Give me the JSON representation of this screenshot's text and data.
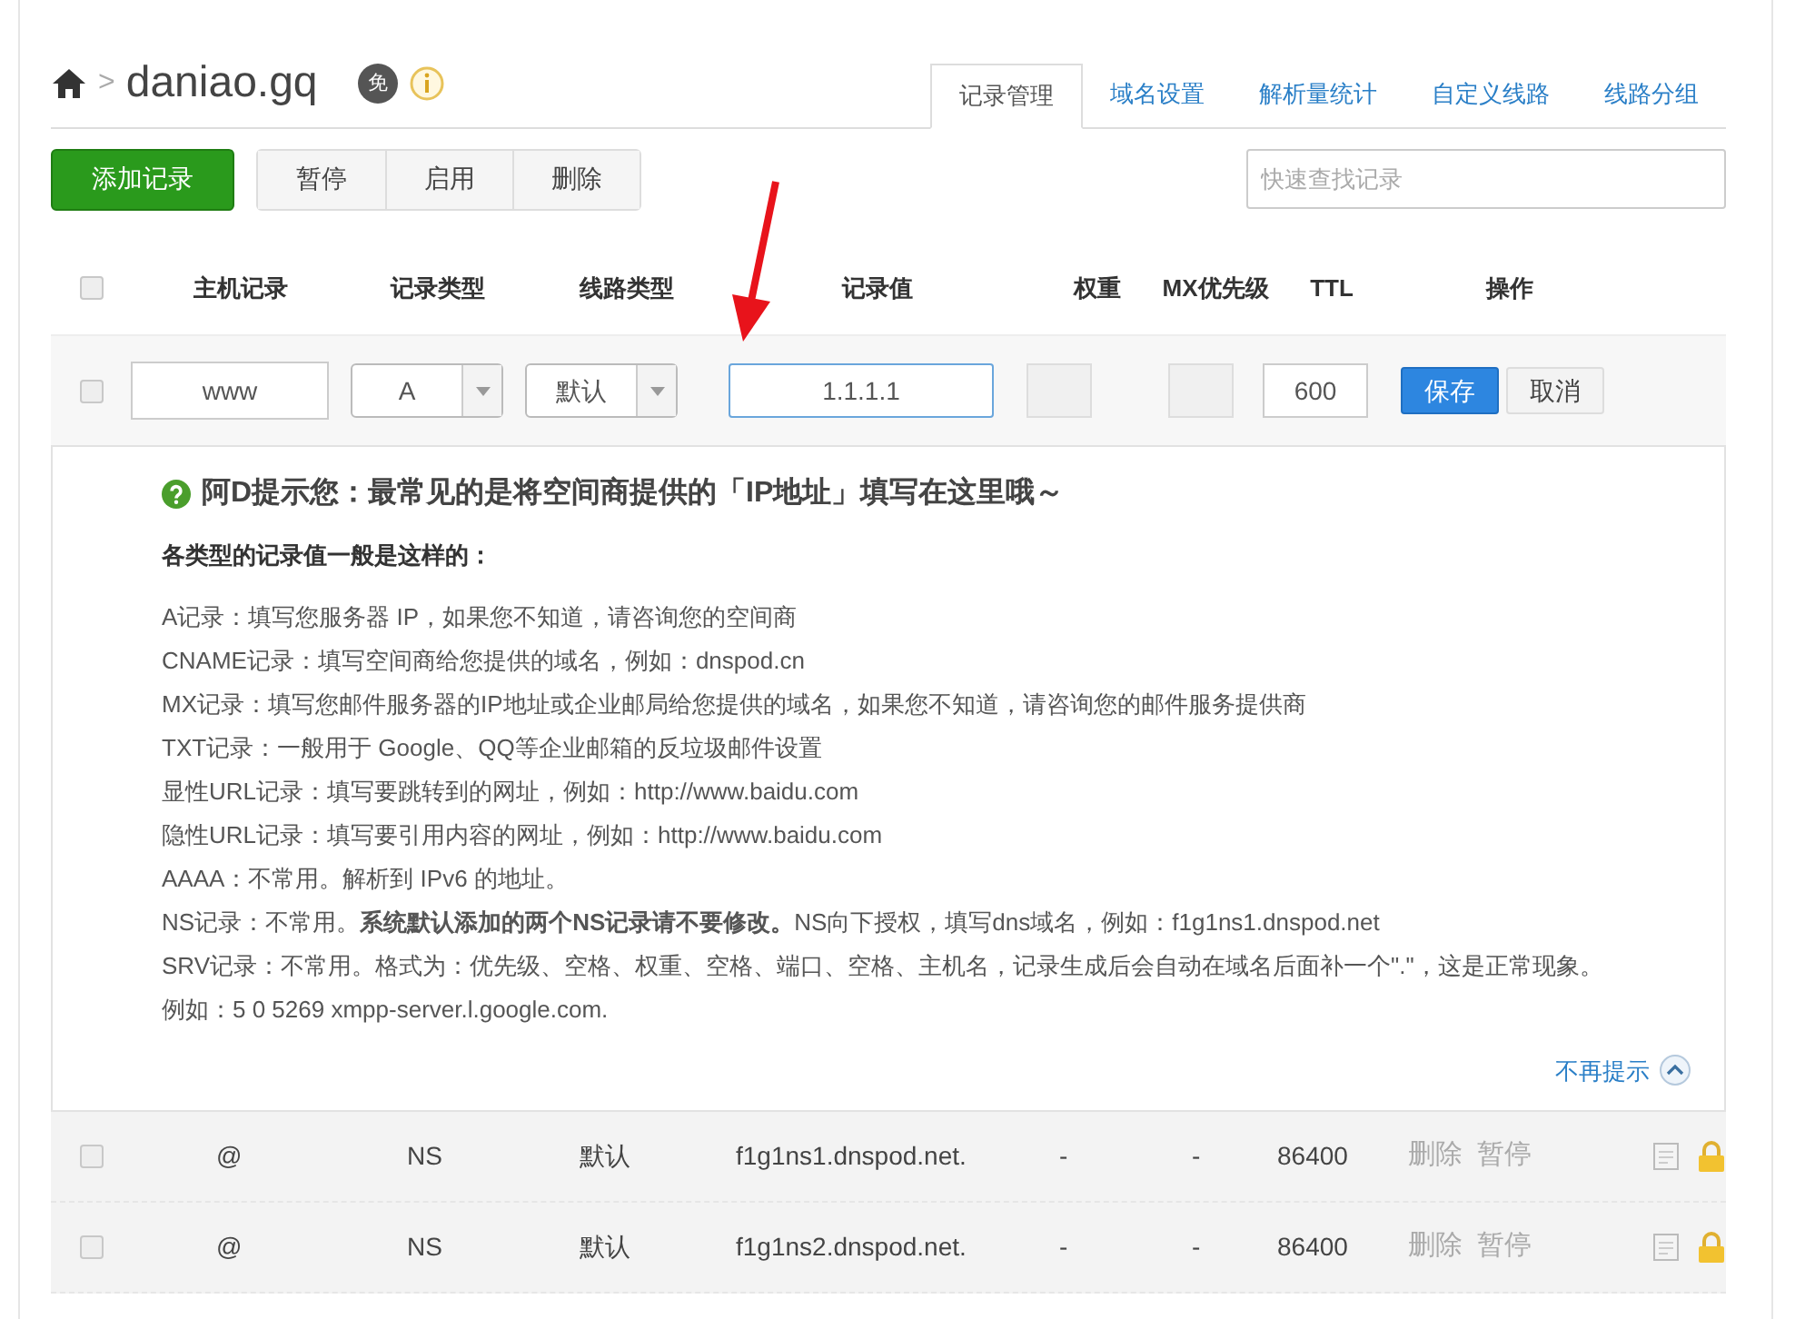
{
  "breadcrumb": {
    "separator": ">",
    "domain": "daniao.gq",
    "badge": "免"
  },
  "tabs": [
    {
      "label": "记录管理",
      "selected": true
    },
    {
      "label": "域名设置",
      "selected": false
    },
    {
      "label": "解析量统计",
      "selected": false
    },
    {
      "label": "自定义线路",
      "selected": false
    },
    {
      "label": "线路分组",
      "selected": false
    }
  ],
  "toolbar": {
    "add_button": "添加记录",
    "buttons": [
      "暂停",
      "启用",
      "删除"
    ],
    "search": {
      "placeholder": "快速查找记录"
    }
  },
  "table": {
    "select_all_checked": false,
    "columns": [
      "主机记录",
      "记录类型",
      "线路类型",
      "记录值",
      "权重",
      "MX优先级",
      "TTL",
      "操作"
    ],
    "edit_row": {
      "checked": false,
      "host": "www",
      "type": "A",
      "line": "默认",
      "value": "1.1.1.1",
      "ttl": "600",
      "save": "保存",
      "cancel": "取消"
    },
    "tip": {
      "title": "阿D提示您：最常见的是将空间商提供的「IP地址」填写在这里哦～",
      "subtitle": "各类型的记录值一般是这样的：",
      "lines": [
        "A记录：填写您服务器 IP，如果您不知道，请咨询您的空间商",
        "CNAME记录：填写空间商给您提供的域名，例如：dnspod.cn",
        "MX记录：填写您邮件服务器的IP地址或企业邮局给您提供的域名，如果您不知道，请咨询您的邮件服务提供商",
        "TXT记录：一般用于 Google、QQ等企业邮箱的反垃圾邮件设置",
        "显性URL记录：填写要跳转到的网址，例如：http://www.baidu.com",
        "隐性URL记录：填写要引用内容的网址，例如：http://www.baidu.com",
        "AAAA：不常用。解析到 IPv6 的地址。",
        "NS记录：不常用。**系统默认添加的两个NS记录请不要修改。**NS向下授权，填写dns域名，例如：f1g1ns1.dnspod.net",
        "SRV记录：不常用。格式为：优先级、空格、权重、空格、端口、空格、主机名，记录生成后会自动在域名后面补一个\".\"，这是正常现象。例如：5 0 5269 xmpp-server.l.google.com."
      ],
      "dismiss": "不再提示"
    },
    "rows": [
      {
        "checked": false,
        "host": "@",
        "type": "NS",
        "line": "默认",
        "value": "f1g1ns1.dnspod.net.",
        "weight": "-",
        "mx": "-",
        "ttl": "86400",
        "actions": [
          "删除",
          "暂停"
        ]
      },
      {
        "checked": false,
        "host": "@",
        "type": "NS",
        "line": "默认",
        "value": "f1g1ns2.dnspod.net.",
        "weight": "-",
        "mx": "-",
        "ttl": "86400",
        "actions": [
          "删除",
          "暂停"
        ]
      }
    ]
  }
}
